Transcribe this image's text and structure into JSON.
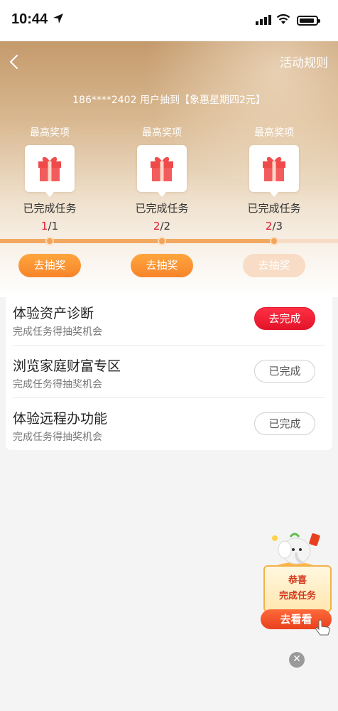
{
  "status_bar": {
    "time": "10:44"
  },
  "header": {
    "rules_label": "活动规则"
  },
  "notice": {
    "text": "186****2402 用户抽到【象惠星期四2元】"
  },
  "prizes": [
    {
      "head": "最高奖项",
      "status": "已完成任务",
      "done": "1",
      "total": "/1",
      "draw_label": "去抽奖",
      "enabled": true
    },
    {
      "head": "最高奖项",
      "status": "已完成任务",
      "done": "2",
      "total": "/2",
      "draw_label": "去抽奖",
      "enabled": true
    },
    {
      "head": "最高奖项",
      "status": "已完成任务",
      "done": "2",
      "total": "/3",
      "draw_label": "去抽奖",
      "enabled": false
    }
  ],
  "tasks": [
    {
      "title": "体验资产诊断",
      "subtitle": "完成任务得抽奖机会",
      "button": "去完成",
      "state": "todo"
    },
    {
      "title": "浏览家庭财富专区",
      "subtitle": "完成任务得抽奖机会",
      "button": "已完成",
      "state": "done"
    },
    {
      "title": "体验远程办功能",
      "subtitle": "完成任务得抽奖机会",
      "button": "已完成",
      "state": "done"
    }
  ],
  "float_ad": {
    "line1": "恭喜",
    "line2": "完成任务",
    "button": "去看看"
  },
  "colors": {
    "accent_orange": "#f7842a",
    "accent_red": "#e3142a",
    "hero_gold": "#c49a6c"
  },
  "icons": [
    "location-arrow-icon",
    "signal-icon",
    "wifi-icon",
    "battery-icon",
    "back-chevron-icon",
    "gift-icon",
    "close-icon",
    "hand-pointer-icon"
  ]
}
